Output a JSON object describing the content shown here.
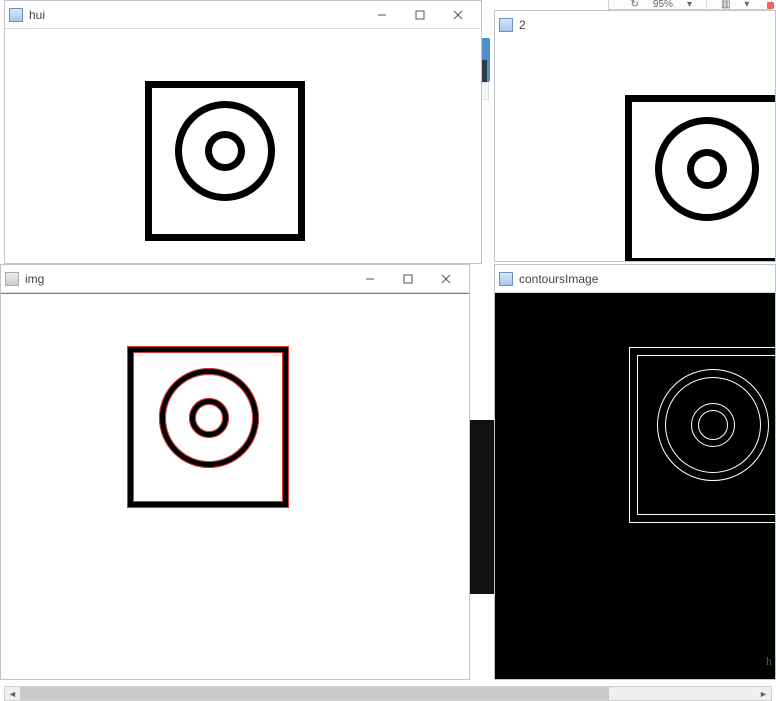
{
  "top_toolbar": {
    "zoom": "95%"
  },
  "corner_letter": "h",
  "windows": {
    "hui": {
      "title": "hui",
      "btn_min": "—",
      "btn_max": "□",
      "btn_close": "✕"
    },
    "img": {
      "title": "img",
      "btn_min": "—",
      "btn_max": "□",
      "btn_close": "✕"
    },
    "two": {
      "title": "2"
    },
    "contours": {
      "title": "contoursImage"
    }
  },
  "scrollbar": {
    "left_arrow": "◄",
    "right_arrow": "►",
    "thumb_pct": 80
  }
}
